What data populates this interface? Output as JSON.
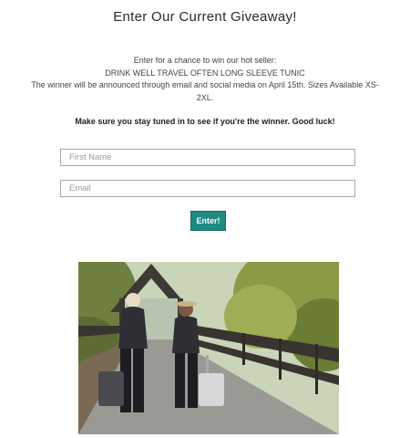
{
  "page": {
    "title": "Enter Our Current Giveaway!",
    "intro_line1": "Enter for a chance to win our hot seller:",
    "intro_line2": "DRINK WELL TRAVEL OFTEN LONG SLEEVE TUNIC",
    "intro_line3": "The winner will be announced through email and social media on April 15th. Sizes Available XS-2XL.",
    "notice": "Make sure you stay tuned in to see if you're the winner. Good luck!"
  },
  "form": {
    "first_name": {
      "value": "",
      "placeholder": "First Name"
    },
    "email": {
      "value": "",
      "placeholder": "Email"
    },
    "submit_label": "Enter!"
  },
  "colors": {
    "accent": "#1e8a82",
    "text": "#333333",
    "border": "#a9a9a9"
  }
}
